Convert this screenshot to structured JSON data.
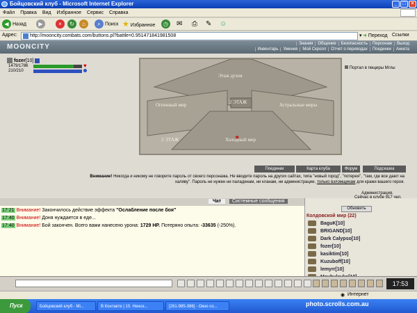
{
  "window": {
    "title": "Бойцовский клуб - Microsoft Internet Explorer"
  },
  "menu": [
    "Файл",
    "Правка",
    "Вид",
    "Избранное",
    "Сервис",
    "Справка"
  ],
  "toolbar": {
    "back": "Назад",
    "search": "Поиск",
    "favorites": "Избранное"
  },
  "address": {
    "label": "Адрес:",
    "url": "http://mooncity.combats.com/buttons.pl?battle=0.951471841981508",
    "go": "Переход",
    "links": "Ссылки"
  },
  "site": {
    "logo": "MOONCITY",
    "nav_top": [
      "Знания",
      "Общение",
      "Безопасность",
      "Персонаж",
      "Выход"
    ],
    "nav_bottom": [
      "Инвентарь",
      "Умения",
      "Мой Скролл",
      "Отчет о переводах",
      "Поединки",
      "Анкета"
    ]
  },
  "player": {
    "name": "fozer",
    "level": "[10]",
    "hp": "1479/1786",
    "mana": "210/210",
    "hp_fraction": 0.83,
    "mana_fraction": 1.0
  },
  "map": {
    "labels": [
      "Этаж духов",
      "Огненный мир",
      "2 ЭТАЖ",
      "Астральные миры",
      "Холодный мир",
      "2 ЭТАЖ"
    ],
    "portal": "Портал в пещеры Мглы"
  },
  "buttons": [
    "Поединки",
    "Карта клуба",
    "Форум",
    "Подсказка"
  ],
  "warning": {
    "bold": "Внимание!",
    "text": "Никогда и никому не говорите пароль от своего персонажа. Не вводите пароль на других сайтах, типа \"новый город\", \"потерея\", \"там, где все дают на халяву\". Пароль не нужен ни паладинам, ни кланам, ни администрации,",
    "link": "только взломщикам",
    "tail": "для кражи вашего героя.",
    "admin": "Администрация.",
    "online": "Сейчас в клубе 917 чел."
  },
  "chat": {
    "tabs": [
      "Чат",
      "Системные сообщения"
    ],
    "lines": [
      {
        "time": "17:21",
        "warn": "Внимание!",
        "text": "Закончилось действие эффекта",
        "bold": "\"Ослабление после боя\""
      },
      {
        "time": "17:40",
        "warn": "Внимание!",
        "text": "Доня нуждается в еде...",
        "bold": ""
      },
      {
        "time": "17:40",
        "warn": "Внимание!",
        "text": "Бой закончен. Всего вами нанесено урона:",
        "bold": "1729 HP.",
        "text2": "Потеряно опыта:",
        "bold2": "-33635",
        "text3": "(-250%)."
      }
    ]
  },
  "online": {
    "refresh": "Обновить",
    "title": "Колдовской мир (22)",
    "players": [
      "BaguK[10]",
      "BRIGAND[10]",
      "Dark Calypso[10]",
      "fozer[10]",
      "kasiktim[10]",
      "Kuzuboff[10]",
      "lemyrr[10]",
      "Maubulevka[10]"
    ]
  },
  "status": {
    "zone": "Интернет",
    "time": "17:53"
  },
  "taskbar": {
    "start": "Пуск",
    "tasks": [
      "Бойцовский клуб - Mi...",
      "В Контакте | 10. Неноз...",
      "[261-985-386] - Окно со..."
    ]
  },
  "watermark": "photo.scrolls.com.au"
}
